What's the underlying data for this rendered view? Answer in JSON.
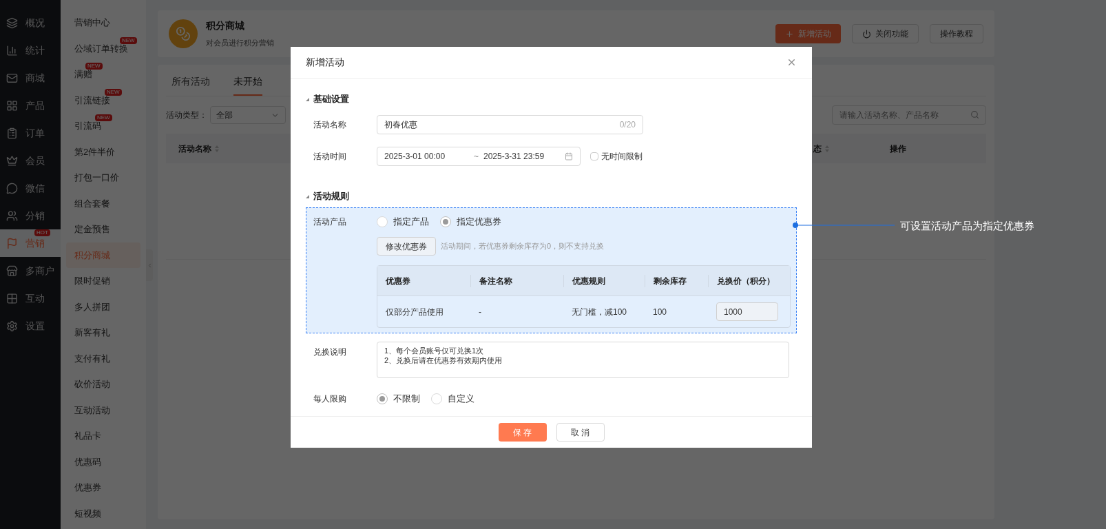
{
  "nav": {
    "items": [
      {
        "label": "概况",
        "selected": false
      },
      {
        "label": "统计",
        "selected": false
      },
      {
        "label": "商城",
        "selected": false
      },
      {
        "label": "产品",
        "selected": false
      },
      {
        "label": "订单",
        "selected": false
      },
      {
        "label": "会员",
        "selected": false
      },
      {
        "label": "微信",
        "selected": false
      },
      {
        "label": "分销",
        "selected": false
      },
      {
        "label": "营销",
        "selected": true,
        "badge": "HOT"
      },
      {
        "label": "多商户",
        "selected": false
      },
      {
        "label": "互动",
        "selected": false
      },
      {
        "label": "设置",
        "selected": false
      }
    ]
  },
  "submenu": {
    "items": [
      {
        "label": "营销中心",
        "selected": false
      },
      {
        "label": "公域订单转换",
        "selected": false,
        "badge": "NEW"
      },
      {
        "label": "满赠",
        "selected": false,
        "badge": "NEW"
      },
      {
        "label": "引流链接",
        "selected": false,
        "badge": "NEW"
      },
      {
        "label": "引流码",
        "selected": false,
        "badge": "NEW"
      },
      {
        "label": "第2件半价",
        "selected": false
      },
      {
        "label": "打包一口价",
        "selected": false
      },
      {
        "label": "组合套餐",
        "selected": false
      },
      {
        "label": "定金预售",
        "selected": false
      },
      {
        "label": "积分商城",
        "selected": true
      },
      {
        "label": "限时促销",
        "selected": false
      },
      {
        "label": "多人拼团",
        "selected": false
      },
      {
        "label": "新客有礼",
        "selected": false
      },
      {
        "label": "支付有礼",
        "selected": false
      },
      {
        "label": "砍价活动",
        "selected": false
      },
      {
        "label": "互动活动",
        "selected": false
      },
      {
        "label": "礼品卡",
        "selected": false
      },
      {
        "label": "优惠码",
        "selected": false
      },
      {
        "label": "优惠券",
        "selected": false
      },
      {
        "label": "短视频",
        "selected": false
      }
    ]
  },
  "header": {
    "title": "积分商城",
    "subtitle": "对会员进行积分营销",
    "buttons": [
      {
        "label": "新增活动",
        "kind": "primary"
      },
      {
        "label": "关闭功能",
        "kind": "power"
      },
      {
        "label": "操作教程",
        "kind": "plain"
      }
    ]
  },
  "tabs": [
    {
      "label": "所有活动",
      "selected": false
    },
    {
      "label": "未开始",
      "selected": true
    }
  ],
  "filter": {
    "label": "活动类型：",
    "value": "全部"
  },
  "search": {
    "placeholder": "请输入活动名称、产品名称"
  },
  "table": {
    "columns": [
      {
        "label": "活动名称",
        "sortable": true
      },
      {
        "label": "态",
        "sortable": true
      },
      {
        "label": "操作",
        "sortable": false
      }
    ]
  },
  "dialog": {
    "title": "新增活动",
    "basic": {
      "title": "基础设置",
      "name": {
        "label": "活动名称",
        "value": "初春优惠",
        "counter": "0/20"
      },
      "time": {
        "label": "活动时间",
        "start": "2025-3-01 00:00",
        "separator": "~",
        "end": "2025-3-31 23:59",
        "no_limit": {
          "label": "无时间限制",
          "checked": false
        }
      }
    },
    "rules": {
      "title": "活动规则",
      "product": {
        "label": "活动产品",
        "options": [
          {
            "label": "指定产品",
            "selected": false
          },
          {
            "label": "指定优惠券",
            "selected": true
          }
        ],
        "button": "修改优惠券",
        "hint": "活动期间，若优惠券剩余库存为0，则不支持兑换",
        "table": {
          "columns": [
            "优惠券",
            "备注名称",
            "优惠规则",
            "剩余库存",
            "兑换价（积分）"
          ],
          "rows": [
            {
              "cells": [
                "仅部分产品使用",
                "-",
                "无门槛，减100",
                "100"
              ],
              "price": "1000"
            }
          ]
        }
      },
      "note": {
        "label": "兑换说明",
        "lines": [
          "1、每个会员账号仅可兑换1次",
          "2、兑换后请在优惠券有效期内使用"
        ]
      },
      "limit": {
        "label": "每人限购",
        "options": [
          {
            "label": "不限制",
            "selected": true
          },
          {
            "label": "自定义",
            "selected": false
          }
        ]
      }
    },
    "buttons": [
      {
        "label": "保 存",
        "kind": "primary"
      },
      {
        "label": "取 消",
        "kind": "plain"
      }
    ]
  },
  "annotation": {
    "text": "可设置活动产品为指定优惠券"
  }
}
